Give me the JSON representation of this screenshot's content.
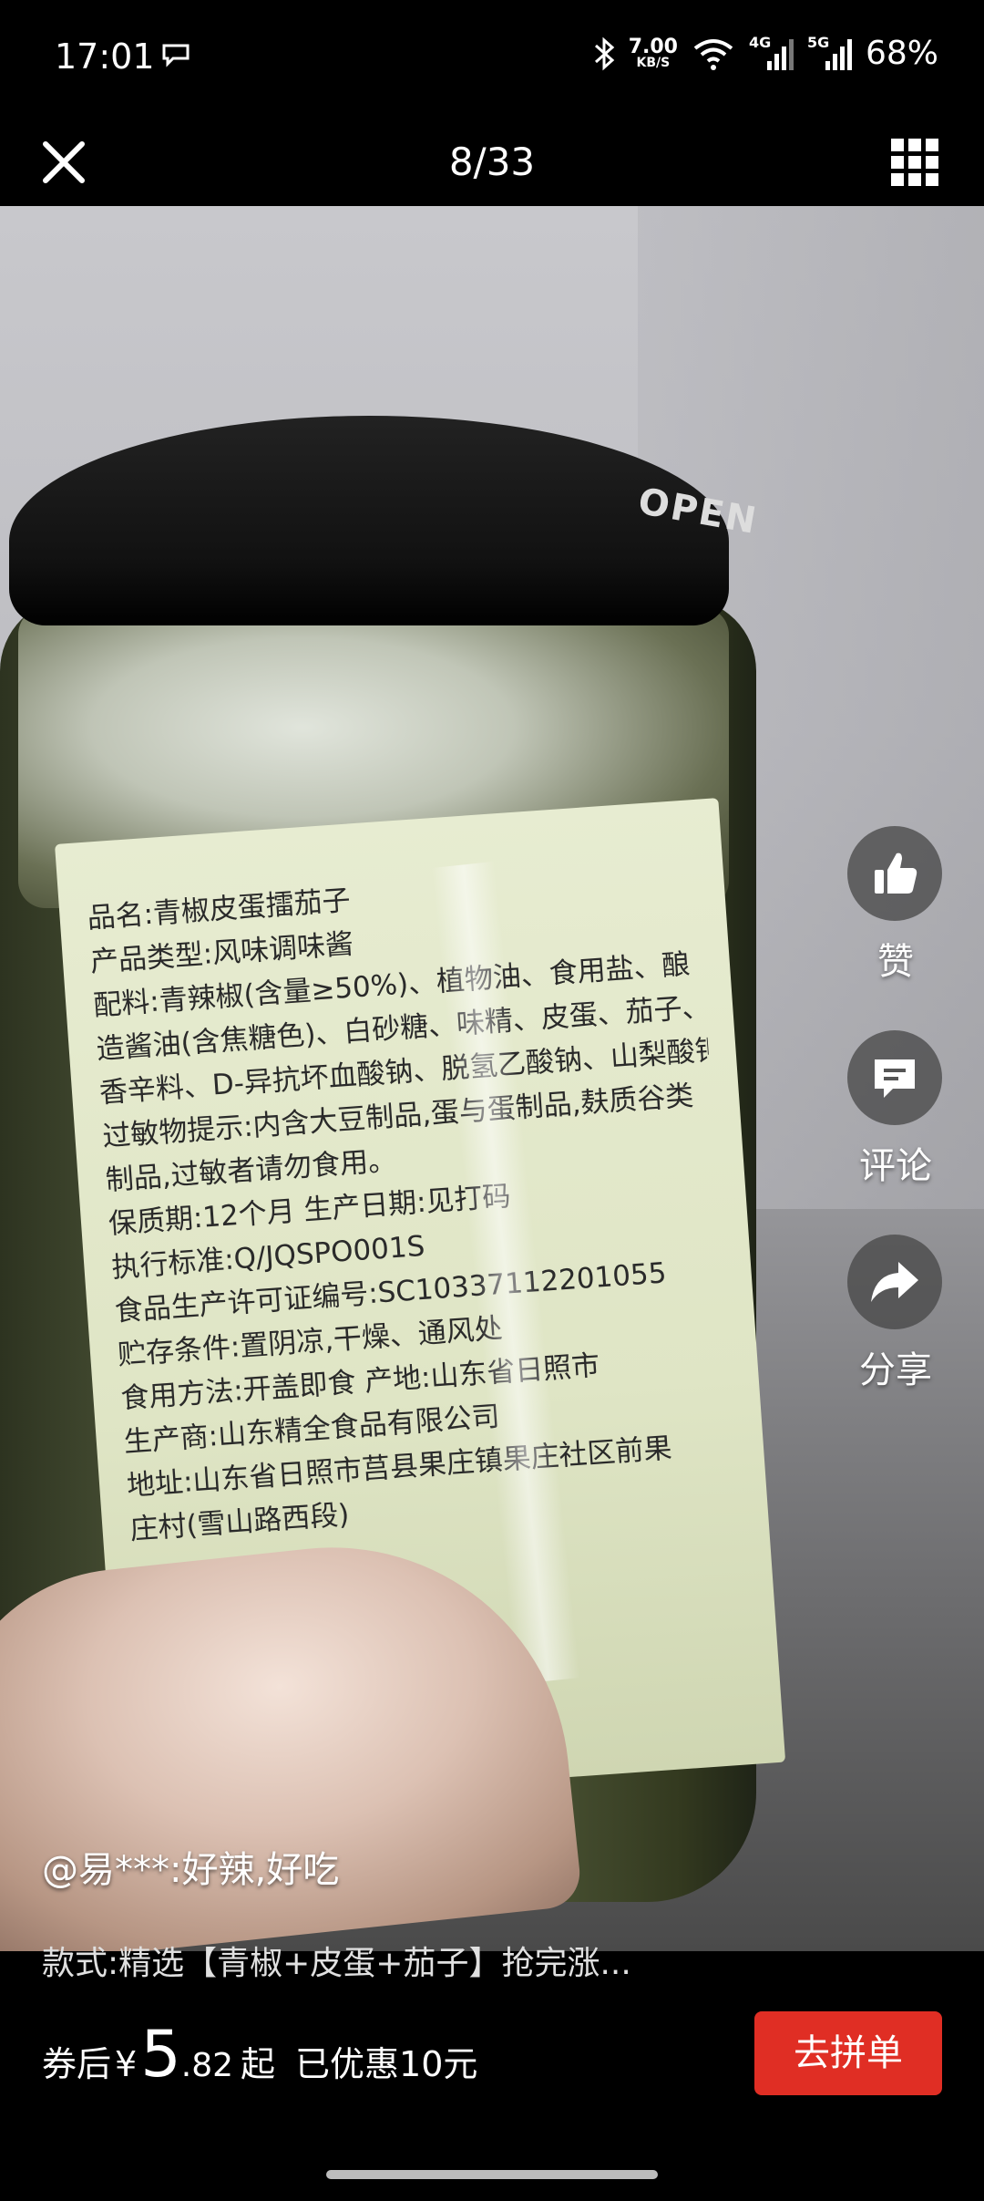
{
  "status_bar": {
    "time": "17:01",
    "speed_value": "7.00",
    "speed_unit": "KB/S",
    "network_4g": "4G",
    "network_5g": "5G",
    "battery": "68%"
  },
  "top_nav": {
    "counter": "8/33"
  },
  "photo": {
    "lid_text": "OPEN",
    "label_lines": [
      "品名:青椒皮蛋擂茄子",
      "产品类型:风味调味酱",
      "配料:青辣椒(含量≥50%)、植物油、食用盐、酿",
      "造酱油(含焦糖色)、白砂糖、味精、皮蛋、茄子、芝麻、",
      "香辛料、D-异抗坏血酸钠、脱氢乙酸钠、山梨酸钾",
      "过敏物提示:内含大豆制品,蛋与蛋制品,麸质谷类",
      "制品,过敏者请勿食用。",
      "保质期:12个月 生产日期:见打码",
      "执行标准:Q/JQSPO001S",
      "食品生产许可证编号:SC10337112201055",
      "贮存条件:置阴凉,干燥、通风处",
      "食用方法:开盖即食 产地:山东省日照市",
      "生产商:山东精全食品有限公司",
      "地址:山东省日照市莒县果庄镇果庄社区前果",
      "庄村(雪山路西段)"
    ]
  },
  "side_actions": {
    "like": "赞",
    "comment": "评论",
    "share": "分享"
  },
  "review": {
    "text": "@易***:好辣,好吃"
  },
  "spec": {
    "text": "款式:精选【青椒+皮蛋+茄子】抢完涨..."
  },
  "price_bar": {
    "prefix": "券后",
    "currency": "¥",
    "integer": "5",
    "decimal": ".82",
    "suffix": "起",
    "saved": "已优惠10元",
    "buy_label": "去拼单"
  },
  "colors": {
    "buy_button": "#e02e24",
    "background": "#000000"
  },
  "icons": [
    "close-icon",
    "grid-icon",
    "thumbs-up-icon",
    "comment-icon",
    "share-icon",
    "bluetooth-icon",
    "wifi-icon",
    "signal-icon",
    "chat-icon"
  ]
}
